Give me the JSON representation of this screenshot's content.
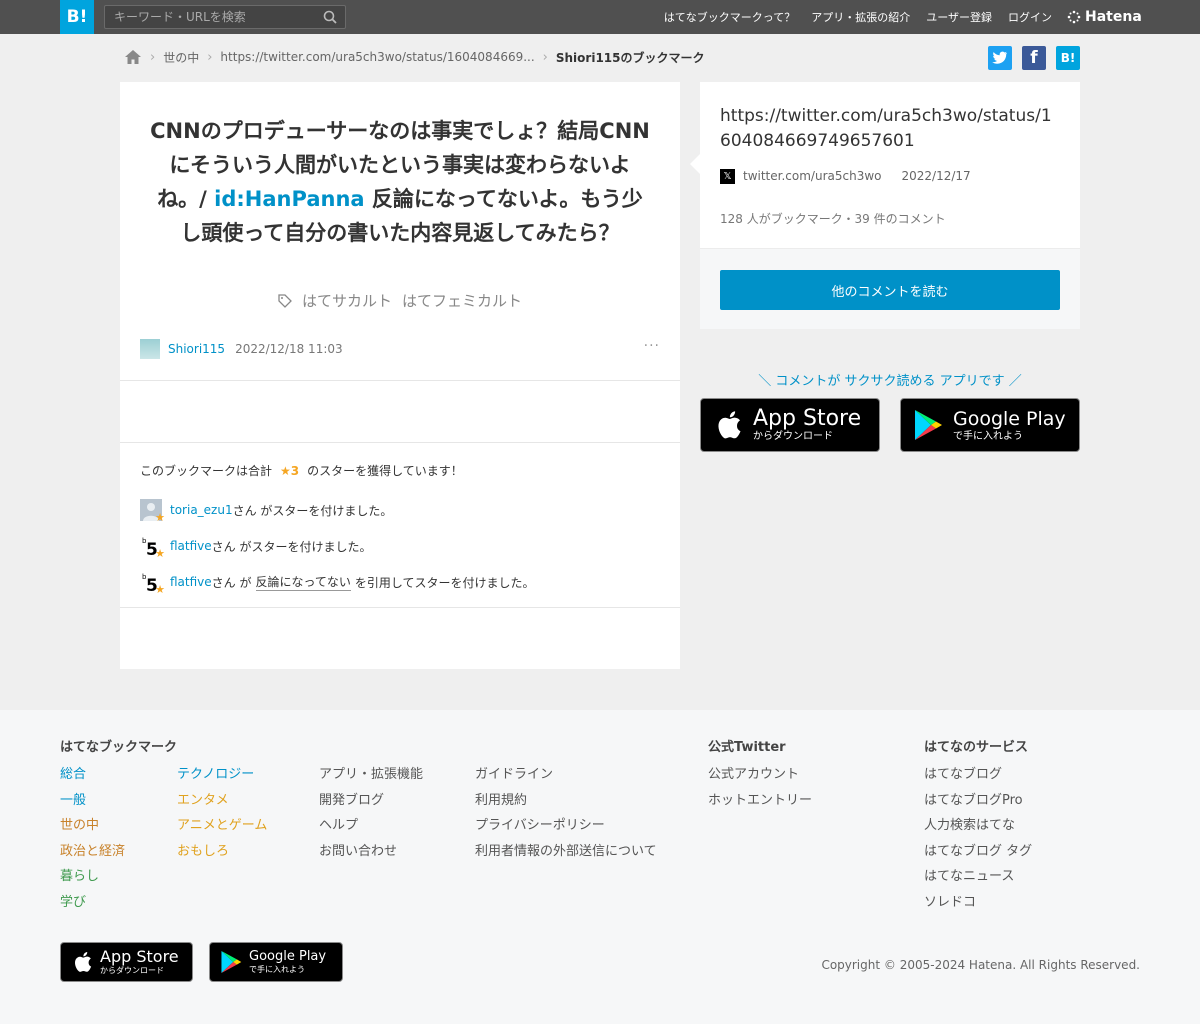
{
  "colors": {
    "brand": "#00a4de",
    "link": "#0091c8",
    "star": "#f5a623",
    "topbar": "#505050"
  },
  "header": {
    "logo": "B!",
    "search_placeholder": "キーワード・URLを検索",
    "nav": [
      "はてなブックマークって？",
      "アプリ・拡張の紹介",
      "ユーザー登録",
      "ログイン"
    ],
    "brand": "Hatena"
  },
  "breadcrumb": {
    "category": "世の中",
    "url": "https://twitter.com/ura5ch3wo/status/1604084669...",
    "current": "Shiori115のブックマーク"
  },
  "share": {
    "twitter": "t",
    "facebook": "f",
    "hatena": "B!"
  },
  "bookmark": {
    "comment_before": "CNNのプロデューサーなのは事実でしょ？結局CNNにそういう人間がいたという事実は変わらないよね。/ ",
    "comment_id": "id:HanPanna",
    "comment_after": " 反論になってないよ。もう少し頭使って自分の書いた内容見返してみたら？",
    "tags": [
      "はてサカルト",
      "はてフェミカルト"
    ],
    "user": "Shiori115",
    "date": "2022/12/18 11:03",
    "more": "···"
  },
  "stars": {
    "summary_before": "このブックマークは合計",
    "summary_count": "★3",
    "summary_after": "のスターを獲得しています！",
    "rows": [
      {
        "user": "toria_ezu1",
        "suffix": "さん がスターを付けました。"
      },
      {
        "user": "flatfive",
        "suffix": "さん がスターを付けました。"
      },
      {
        "user": "flatfive",
        "mid": "さん が",
        "quote": "反論になってない",
        "suffix": "を引用してスターを付けました。"
      }
    ]
  },
  "entry": {
    "title": "https://twitter.com/ura5ch3wo/status/1604084669749657601",
    "domain": "twitter.com/ura5ch3wo",
    "date": "2022/12/17",
    "counts": "128 人がブックマーク・39 件のコメント",
    "read_button": "他のコメントを読む"
  },
  "promo": {
    "text": "＼ コメントが サクサク読める アプリです ／",
    "appstore_big": "App Store",
    "appstore_small": "からダウンロード",
    "googleplay_big": "Google Play",
    "googleplay_small": "で手に入れよう"
  },
  "footer": {
    "col_heading_1": "はてなブックマーク",
    "categories_a": [
      "総合",
      "一般",
      "世の中",
      "政治と経済",
      "暮らし",
      "学び"
    ],
    "categories_b": [
      "テクノロジー",
      "エンタメ",
      "アニメとゲーム",
      "おもしろ"
    ],
    "links_a": [
      "アプリ・拡張機能",
      "開発ブログ",
      "ヘルプ",
      "お問い合わせ"
    ],
    "links_b": [
      "ガイドライン",
      "利用規約",
      "プライバシーポリシー",
      "利用者情報の外部送信について"
    ],
    "col_heading_2": "公式Twitter",
    "twitter_links": [
      "公式アカウント",
      "ホットエントリー"
    ],
    "col_heading_3": "はてなのサービス",
    "services": [
      "はてなブログ",
      "はてなブログPro",
      "人力検索はてな",
      "はてなブログ タグ",
      "はてなニュース",
      "ソレドコ"
    ],
    "copyright": "Copyright © 2005-2024 Hatena. All Rights Reserved."
  }
}
